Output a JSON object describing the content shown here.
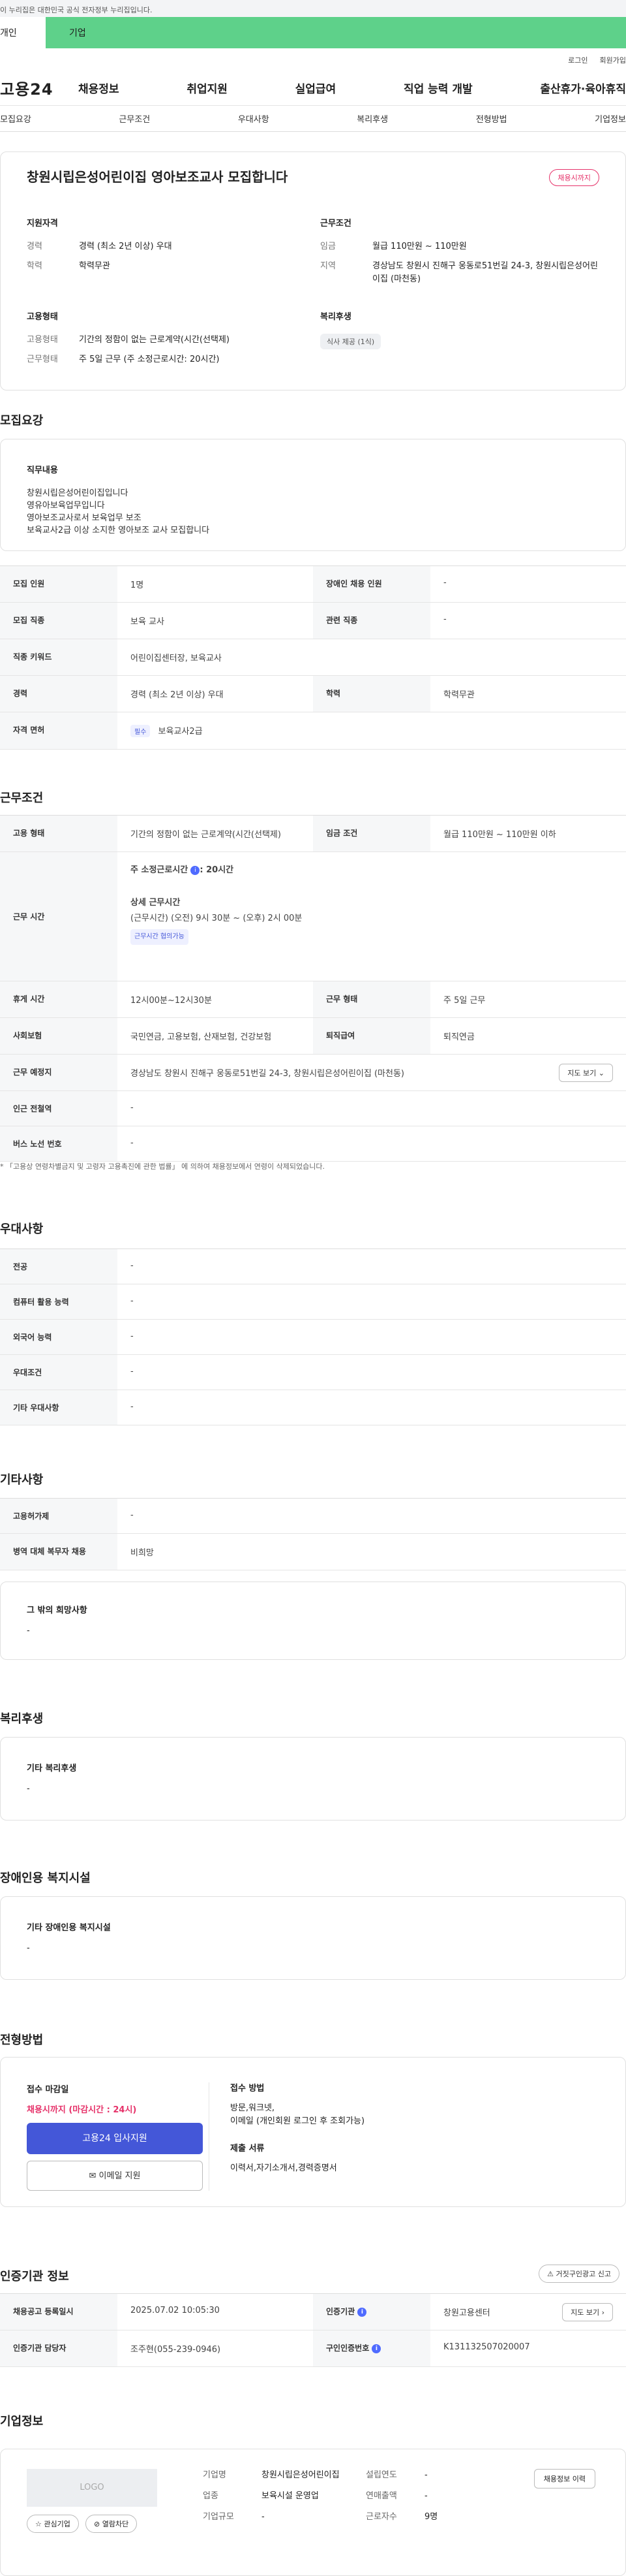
{
  "gov_notice": "이 누리집은 대한민국 공식 전자정부 누리집입니다.",
  "user_tabs": [
    "개인",
    "기업"
  ],
  "util_links": [
    "로그인",
    "회원가입"
  ],
  "logo": "고용24",
  "gnb": [
    "채용정보",
    "취업지원",
    "실업급여",
    "직업 능력 개발",
    "출산휴가·육아휴직"
  ],
  "tabnav": [
    "모집요강",
    "근무조건",
    "우대사항",
    "복리후생",
    "전형방법",
    "기업정보"
  ],
  "title": "창원시립은성어린이집 영아보조교사 모집합니다",
  "status_badge": "채용시까지",
  "summary": {
    "qual_title": "지원자격",
    "career_label": "경력",
    "career": "경력 (최소 2년 이상) 우대",
    "edu_label": "학력",
    "edu": "학력무관",
    "cond_title": "근무조건",
    "wage_label": "임금",
    "wage": "월급 110만원 ~ 110만원",
    "region_label": "지역",
    "region": "경상남도 창원시 진해구 웅동로51번길 24-3, 창원시립은성어린이집 (마천동)",
    "emp_title": "고용형태",
    "emp_label": "고용형태",
    "emp": "기간의 정함이 없는 근로계약(시간(선택제)",
    "worktime_label": "근무형태",
    "worktime": "주 5일 근무 (주 소정근로시간: 20시간)",
    "welfare_title": "복리후생",
    "welfare_chip": "식사 제공 (1식)"
  },
  "recruit": {
    "title": "모집요강",
    "duty_title": "직무내용",
    "duty_lines": [
      "창원시립은성어린이집입니다",
      "영유아보육업무입니다",
      "영아보조교사로서 보육업무 보조",
      "보육교사2급 이상 소지한 영아보조 교사 모집합니다"
    ],
    "rows": {
      "count_k": "모집 인원",
      "count_v": "1명",
      "disabled_k": "장애인 채용 인원",
      "disabled_v": "-",
      "job_k": "모집 직종",
      "job_v": "보육 교사",
      "related_k": "관련 직종",
      "related_v": "-",
      "keyword_k": "직종 키워드",
      "keyword_v": "어린이집센터장, 보육교사",
      "career_k": "경력",
      "career_v": "경력 (최소 2년 이상) 우대",
      "edu_k": "학력",
      "edu_v": "학력무관",
      "license_k": "자격 면허",
      "license_badge": "필수",
      "license_v": "보육교사2급"
    }
  },
  "conditions": {
    "title": "근무조건",
    "emp_k": "고용 형태",
    "emp_v": "기간의 정함이 없는 근로계약(시간(선택제)",
    "wage_k": "임금 조건",
    "wage_v": "월급 110만원 ~ 110만원 이하",
    "hours_k": "근무 시간",
    "weekly_label": "주 소정근로시간",
    "weekly_v": ": 20시간",
    "detail_label": "상세 근무시간",
    "detail_v": "(근무시간) (오전) 9시 30분 ~ (오후) 2시 00분",
    "consult_badge": "근무시간 협의가능",
    "break_k": "휴게 시간",
    "break_v": "12시00분~12시30분",
    "form_k": "근무 형태",
    "form_v": "주 5일 근무",
    "insurance_k": "사회보험",
    "insurance_v": "국민연금, 고용보험, 산재보험, 건강보험",
    "severance_k": "퇴직급여",
    "severance_v": "퇴직연금",
    "place_k": "근무 예정지",
    "place_v": "경상남도 창원시 진해구 웅동로51번길 24-3, 창원시립은성어린이집 (마천동)",
    "map_btn": "지도 보기",
    "station_k": "인근 전철역",
    "station_v": "-",
    "bus_k": "버스 노선 번호",
    "bus_v": "-",
    "note": "* 「고용상 연령차별금지 및 고령자 고용촉진에 관한 법률」 에 의하여 채용정보에서 연령이 삭제되었습니다."
  },
  "preference": {
    "title": "우대사항",
    "rows": [
      {
        "k": "전공",
        "v": "-"
      },
      {
        "k": "컴퓨터 활용 능력",
        "v": "-"
      },
      {
        "k": "외국어 능력",
        "v": "-"
      },
      {
        "k": "우대조건",
        "v": "-"
      },
      {
        "k": "기타 우대사항",
        "v": "-"
      }
    ]
  },
  "etc": {
    "title": "기타사항",
    "rows": [
      {
        "k": "고용허가제",
        "v": "-"
      },
      {
        "k": "병역 대체 복무자 채용",
        "v": "비희망"
      }
    ],
    "hope_title": "그 밖의 희망사항",
    "hope_v": "-"
  },
  "welfare": {
    "title": "복리후생",
    "sub": "기타 복리후생",
    "v": "-"
  },
  "disability": {
    "title": "장애인용 복지시설",
    "sub": "기타 장애인용 복지시설",
    "v": "-"
  },
  "process": {
    "title": "전형방법",
    "deadline_title": "접수 마감일",
    "deadline_v": "채용시까지 (마감시간 : 24시)",
    "apply_btn": "고용24 입사지원",
    "email_btn": "이메일 지원",
    "method_title": "접수 방법",
    "method_v1": "방문,워크넷,",
    "method_v2": "이메일 (개인회원 로그인 후 조회가능)",
    "docs_title": "제출 서류",
    "docs_v": "이력서,자기소개서,경력증명서"
  },
  "agency": {
    "title": "인증기관 정보",
    "report_btn": "거짓구인광고 신고",
    "reg_k": "채용공고 등록일시",
    "reg_v": "2025.07.02 10:05:30",
    "org_k": "인증기관",
    "org_v": "창원고용센터",
    "map_btn": "지도 보기",
    "manager_k": "인증기관 담당자",
    "manager_v": "조주현(055-239-0946)",
    "reqno_k": "구인인증번호",
    "reqno_v": "K131132507020007"
  },
  "company": {
    "title": "기업정보",
    "logo_text": "LOGO",
    "interest_btn": "관심기업",
    "block_btn": "열람차단",
    "name_k": "기업명",
    "name_v": "창원시립은성어린이집",
    "industry_k": "업종",
    "industry_v": "보육시설 운영업",
    "scale_k": "기업규모",
    "scale_v": "-",
    "founded_k": "설립연도",
    "founded_v": "-",
    "sales_k": "연매출액",
    "sales_v": "-",
    "employees_k": "근로자수",
    "employees_v": "9명",
    "history_btn": "채용정보 이력"
  }
}
